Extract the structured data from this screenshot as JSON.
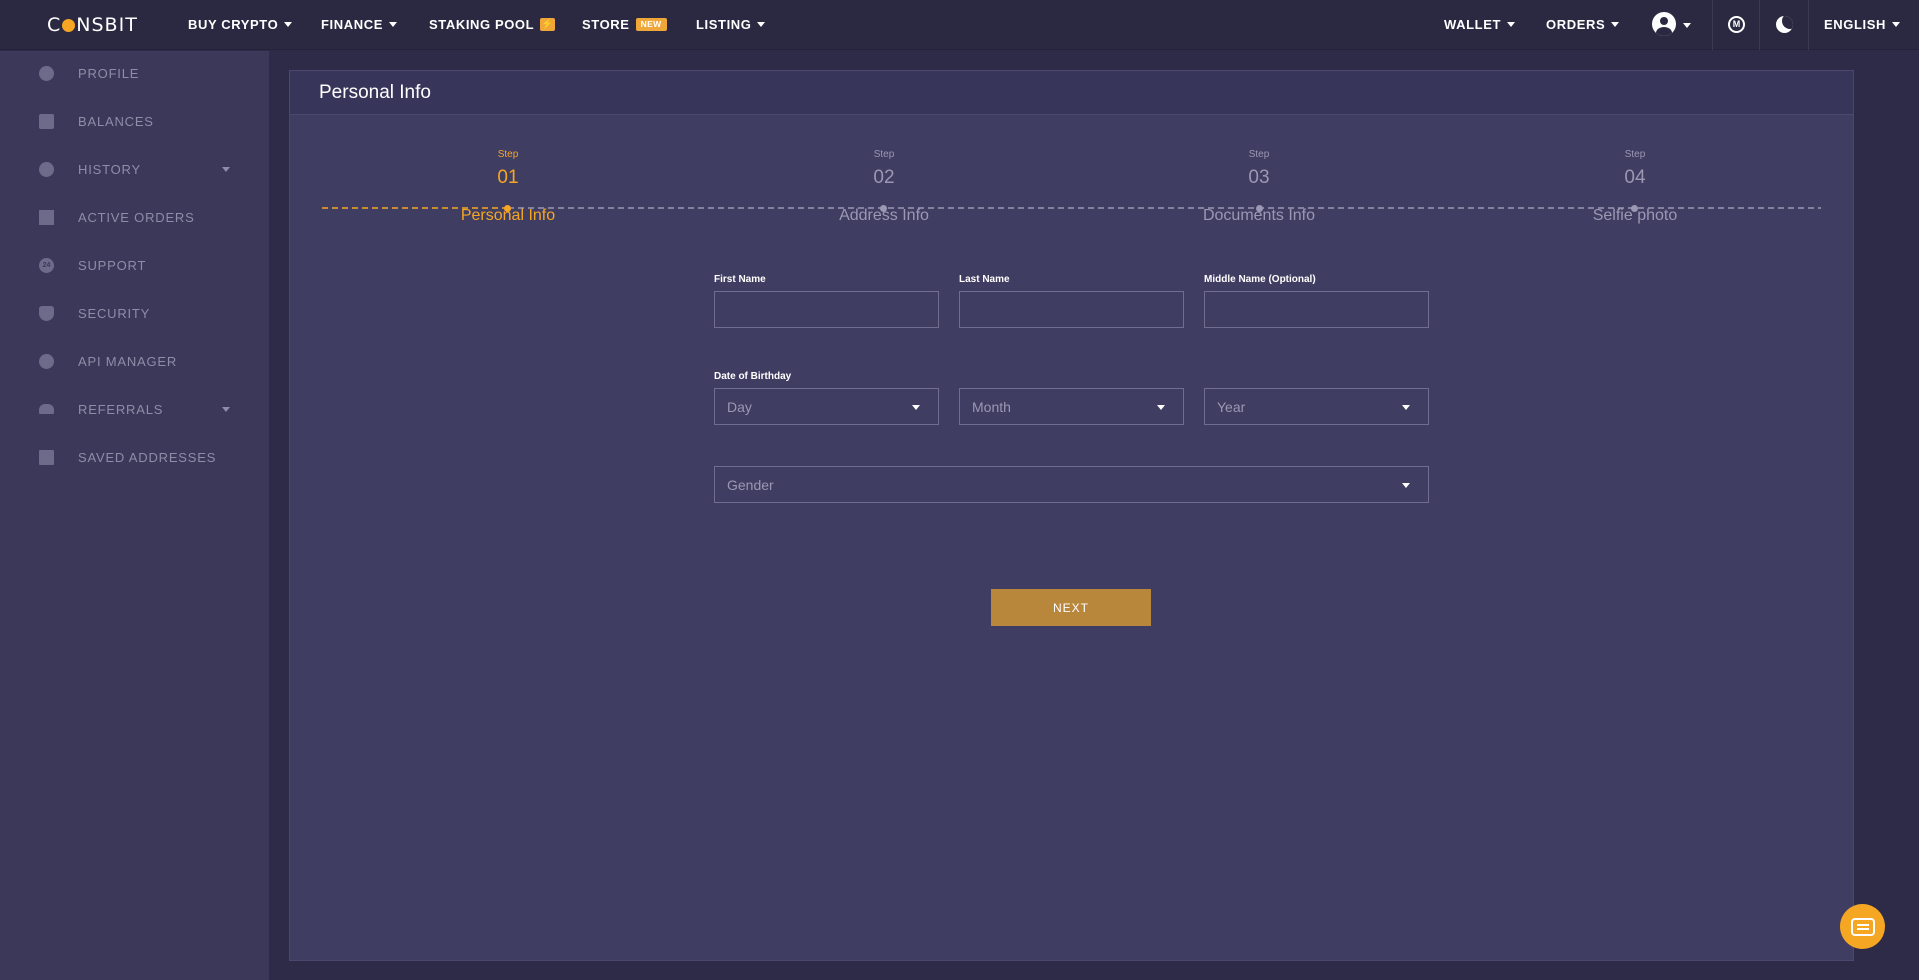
{
  "brand": {
    "logo_text_left": "C",
    "logo_text_right": "NSBIT"
  },
  "topnav": {
    "buy_crypto": "BUY CRYPTO",
    "finance": "FINANCE",
    "staking_pool": "STAKING POOL",
    "staking_badge": "⚡",
    "store": "STORE",
    "store_badge": "NEW",
    "listing": "LISTING",
    "wallet": "WALLET",
    "orders": "ORDERS",
    "cmc_glyph": "M",
    "language": "ENGLISH"
  },
  "sidebar": {
    "items": [
      {
        "label": "PROFILE",
        "icon": "profile-icon"
      },
      {
        "label": "BALANCES",
        "icon": "wallet-icon"
      },
      {
        "label": "HISTORY",
        "icon": "clock-icon"
      },
      {
        "label": "ACTIVE ORDERS",
        "icon": "orders-icon"
      },
      {
        "label": "SUPPORT",
        "icon": "support-24-icon",
        "badge": "24"
      },
      {
        "label": "SECURITY",
        "icon": "shield-icon"
      },
      {
        "label": "API MANAGER",
        "icon": "key-icon"
      },
      {
        "label": "REFERRALS",
        "icon": "people-icon"
      },
      {
        "label": "SAVED ADDRESSES",
        "icon": "calendar-icon"
      }
    ]
  },
  "card": {
    "title": "Personal Info"
  },
  "steps": [
    {
      "label": "Step",
      "num": "01",
      "name": "Personal Info",
      "active": true
    },
    {
      "label": "Step",
      "num": "02",
      "name": "Address Info",
      "active": false
    },
    {
      "label": "Step",
      "num": "03",
      "name": "Documents Info",
      "active": false
    },
    {
      "label": "Step",
      "num": "04",
      "name": "Selfie photo",
      "active": false
    }
  ],
  "form": {
    "first_name_label": "First Name",
    "first_name_value": "",
    "last_name_label": "Last Name",
    "last_name_value": "",
    "middle_name_label": "Middle Name (Optional)",
    "middle_name_value": "",
    "dob_label": "Date of Birthday",
    "day_placeholder": "Day",
    "month_placeholder": "Month",
    "year_placeholder": "Year",
    "gender_placeholder": "Gender",
    "next_label": "NEXT"
  },
  "colors": {
    "accent": "#f5a623",
    "button": "#b9873c",
    "sidebar_bg": "#3b3859",
    "card_bg": "#403d62",
    "nav_bg": "#2b2941"
  }
}
